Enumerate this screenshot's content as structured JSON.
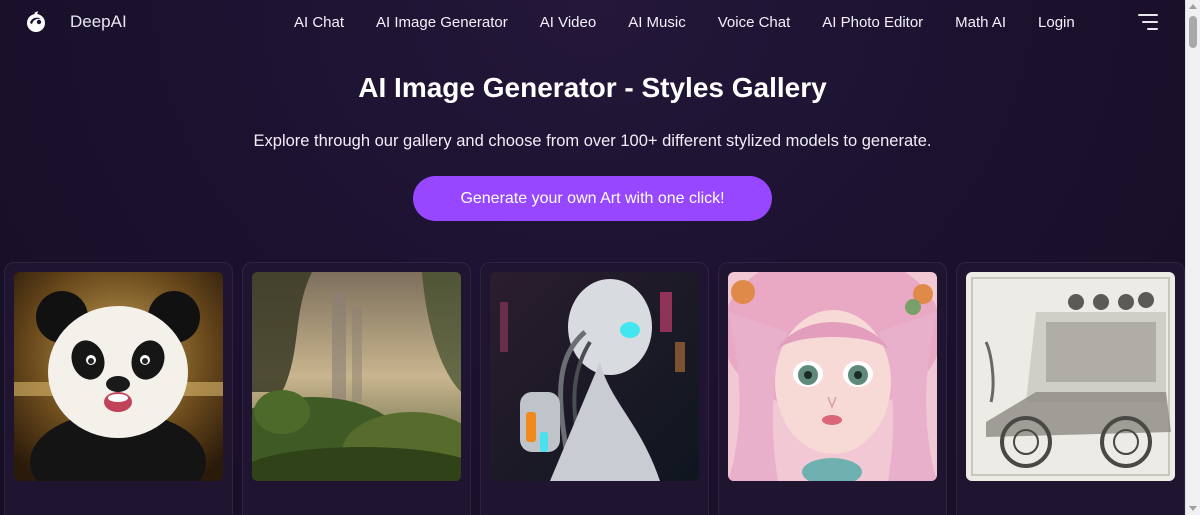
{
  "header": {
    "brand": "DeepAI",
    "nav": [
      {
        "label": "AI Chat"
      },
      {
        "label": "AI Image Generator"
      },
      {
        "label": "AI Video"
      },
      {
        "label": "AI Music"
      },
      {
        "label": "Voice Chat"
      },
      {
        "label": "AI Photo Editor"
      },
      {
        "label": "Math AI"
      },
      {
        "label": "Login"
      }
    ],
    "menu_icon": "hamburger-menu-icon"
  },
  "hero": {
    "title": "AI Image Generator - Styles Gallery",
    "subtitle": "Explore through our gallery and choose from over 100+ different stylized models to generate.",
    "cta_label": "Generate your own Art with one click!"
  },
  "gallery": {
    "items": [
      {
        "subject": "panda"
      },
      {
        "subject": "misty jungle landscape"
      },
      {
        "subject": "cyborg robot"
      },
      {
        "subject": "anime girl with pink hair"
      },
      {
        "subject": "sketch of vintage car"
      }
    ]
  },
  "colors": {
    "background": "#1c1230",
    "accent": "#9747ff",
    "card": "#1f1530"
  }
}
